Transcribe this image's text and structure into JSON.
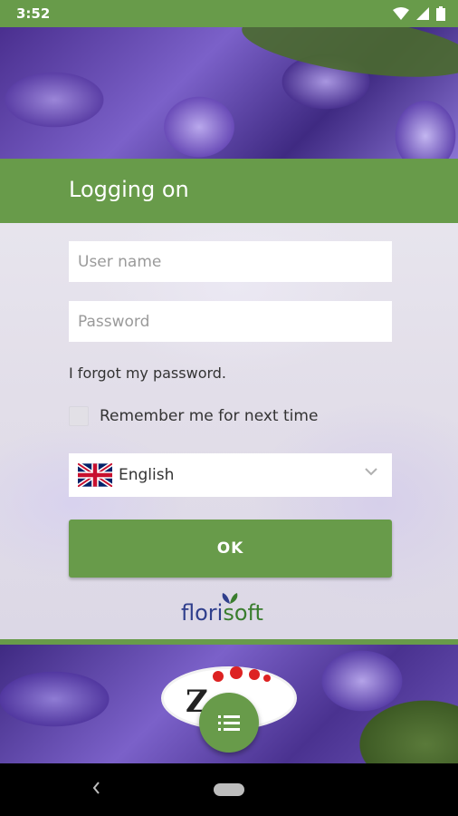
{
  "status_bar": {
    "time": "3:52"
  },
  "header": {
    "title": "Logging on"
  },
  "form": {
    "username_placeholder": "User name",
    "password_placeholder": "Password",
    "forgot_password_link": "I forgot my password.",
    "remember_me_label": "Remember me for next time",
    "remember_me_checked": false,
    "language": {
      "selected": "English",
      "flag_icon": "uk-flag-icon"
    },
    "ok_button": "OK"
  },
  "branding": {
    "logo_part1": "flori",
    "logo_part2": "soft"
  },
  "colors": {
    "primary_green": "#689b4a",
    "logo_blue": "#2f3e8c",
    "logo_green": "#3a7d2e"
  },
  "fab": {
    "icon": "menu-list-icon"
  }
}
